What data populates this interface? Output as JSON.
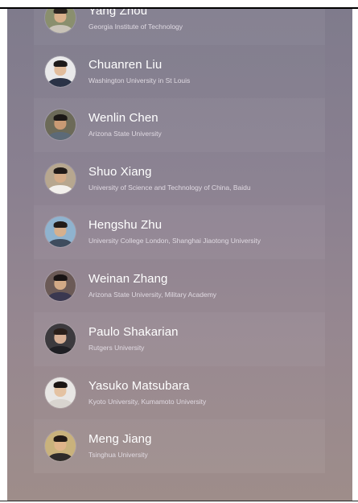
{
  "people": [
    {
      "name": "Yang Zhou",
      "affiliation": "Georgia Institute of Technology",
      "avatar": {
        "bg": "#8a8f6e",
        "face": "#d9b08c",
        "hair": "#2b2420",
        "body": "#c9c3b8"
      }
    },
    {
      "name": "Chuanren Liu",
      "affiliation": "Washington University in St Louis",
      "avatar": {
        "bg": "#e9e9ea",
        "face": "#e2bd9c",
        "hair": "#1d1a1a",
        "body": "#2b3347"
      }
    },
    {
      "name": "Wenlin Chen",
      "affiliation": "Arizona State University",
      "avatar": {
        "bg": "#6c6a58",
        "face": "#c99a74",
        "hair": "#1c1816",
        "body": "#5c6a78"
      }
    },
    {
      "name": "Shuo Xiang",
      "affiliation": "University of Science and Technology of China, Baidu",
      "avatar": {
        "bg": "#b7a78f",
        "face": "#d4ac88",
        "hair": "#201a17",
        "body": "#f2f0ec"
      }
    },
    {
      "name": "Hengshu Zhu",
      "affiliation": "University College London, Shanghai Jiaotong University",
      "avatar": {
        "bg": "#8fb3cf",
        "face": "#d6b08e",
        "hair": "#221c19",
        "body": "#3f4c5e"
      }
    },
    {
      "name": "Weinan Zhang",
      "affiliation": "Arizona State University, Military Academy",
      "avatar": {
        "bg": "#6b5a56",
        "face": "#d3aa86",
        "hair": "#191414",
        "body": "#3a3850"
      }
    },
    {
      "name": "Paulo Shakarian",
      "affiliation": "Rutgers University",
      "avatar": {
        "bg": "#3c3a3e",
        "face": "#d7b096",
        "hair": "#2a1f1a",
        "body": "#1f1f24"
      }
    },
    {
      "name": "Yasuko Matsubara",
      "affiliation": "Kyoto University, Kumamoto University",
      "avatar": {
        "bg": "#e8e6e4",
        "face": "#e4c2a2",
        "hair": "#1a1514",
        "body": "#d8d4cf"
      }
    },
    {
      "name": "Meng Jiang",
      "affiliation": "Tsinghua University",
      "avatar": {
        "bg": "#c9b27c",
        "face": "#dfb48a",
        "hair": "#231b16",
        "body": "#2d2b2a"
      }
    }
  ]
}
